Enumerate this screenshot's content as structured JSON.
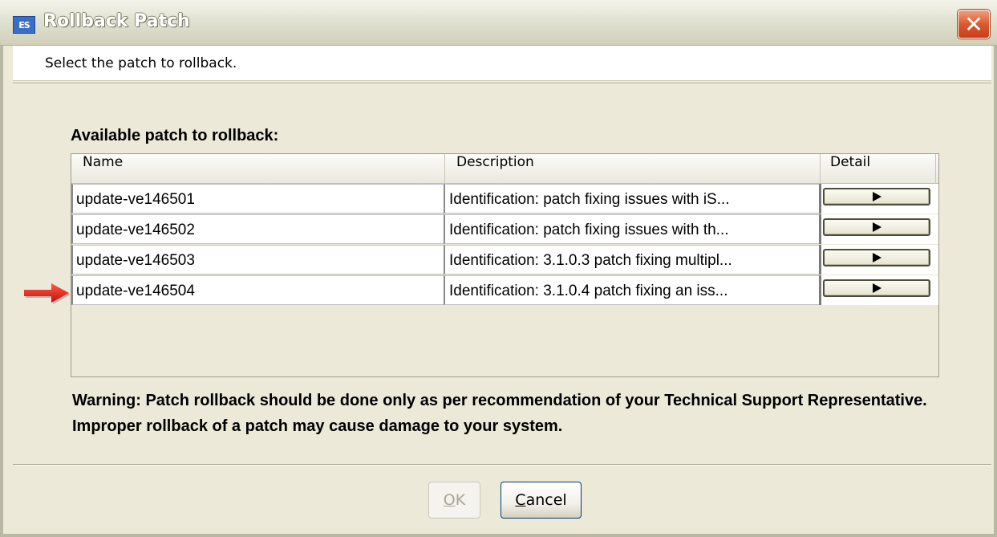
{
  "window": {
    "title": "Rollback Patch",
    "app_icon_text": "ES"
  },
  "header": {
    "text": "Select the patch to rollback."
  },
  "main": {
    "section_label": "Available patch to rollback:",
    "columns": [
      "Name",
      "Description",
      "Detail"
    ],
    "rows": [
      {
        "name": "update-ve146501",
        "description": "Identification: patch fixing issues with iS..."
      },
      {
        "name": "update-ve146502",
        "description": "Identification: patch fixing issues with th..."
      },
      {
        "name": "update-ve146503",
        "description": "Identification: 3.1.0.3 patch fixing multipl..."
      },
      {
        "name": "update-ve146504",
        "description": "Identification: 3.1.0.4 patch fixing an iss..."
      }
    ],
    "warning": "Warning: Patch rollback should be done only as per recommendation of your Technical Support Representative. Improper rollback of a patch may cause damage to your system."
  },
  "buttons": {
    "ok_mnemonic": "O",
    "ok_rest": "K",
    "cancel_mnemonic": "C",
    "cancel_rest": "ancel"
  },
  "icons": {
    "detail": "play-icon",
    "close": "close-icon",
    "pointer": "red-arrow-icon"
  },
  "colors": {
    "close_button": "#dc5a32",
    "arrow": "#e0201a",
    "dialog_bg": "#ece9d8"
  }
}
